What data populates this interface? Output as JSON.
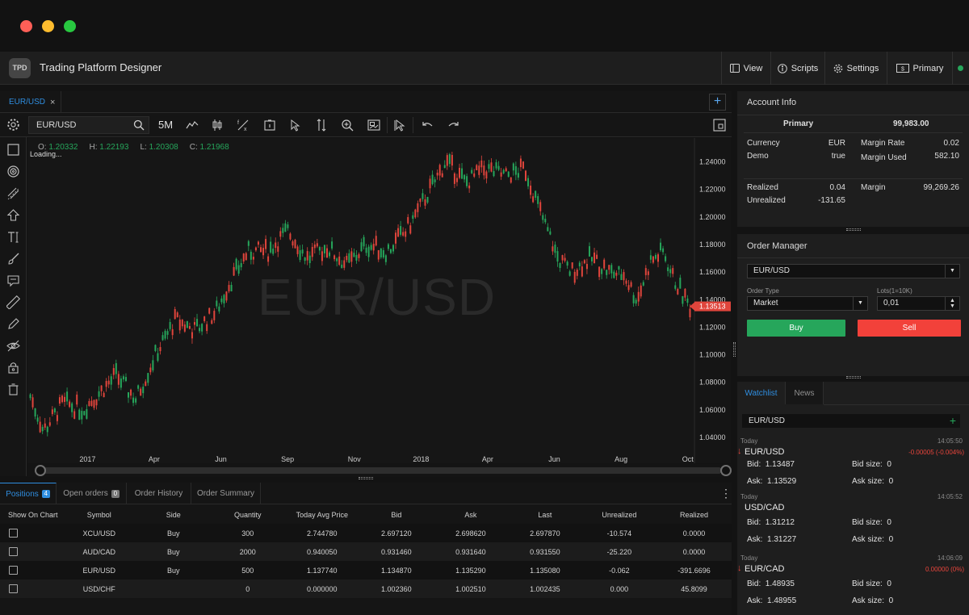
{
  "window": {
    "traffic_colors": {
      "close": "#fe5f57",
      "minimize": "#febc2e",
      "zoom": "#28c840"
    }
  },
  "app": {
    "logo_text": "TPD",
    "title": "Trading Platform Designer",
    "nav": [
      {
        "label": "View",
        "icon": "window-icon"
      },
      {
        "label": "Scripts",
        "icon": "info-icon"
      },
      {
        "label": "Settings",
        "icon": "gear-icon"
      },
      {
        "label": "Primary",
        "icon": "dollar-bill-icon"
      }
    ],
    "status_color": "#26a65b"
  },
  "chart_tab": {
    "label": "EUR/USD",
    "close": "×",
    "add": "+"
  },
  "toolbar": {
    "symbol": "EUR/USD",
    "timeframe": "5M"
  },
  "chart": {
    "ohlc": {
      "o_label": "O:",
      "o": "1.20332",
      "h_label": "H:",
      "h": "1.22193",
      "l_label": "L:",
      "l": "1.20308",
      "c_label": "C:",
      "c": "1.21968"
    },
    "loading": "Loading...",
    "watermark": "EUR/USD",
    "current_price": "1.13513"
  },
  "chart_data": {
    "type": "candlestick",
    "title": "EUR/USD",
    "x_ticks": [
      "2017",
      "Apr",
      "Jun",
      "Sep",
      "Nov",
      "2018",
      "Apr",
      "Jun",
      "Aug",
      "Oct"
    ],
    "y_ticks": [
      "1.24000",
      "1.22000",
      "1.20000",
      "1.18000",
      "1.16000",
      "1.14000",
      "1.12000",
      "1.10000",
      "1.08000",
      "1.06000",
      "1.04000"
    ],
    "ylim": [
      1.03,
      1.255
    ],
    "trend": [
      [
        0,
        1.07
      ],
      [
        0.02,
        1.045
      ],
      [
        0.05,
        1.065
      ],
      [
        0.08,
        1.06
      ],
      [
        0.1,
        1.07
      ],
      [
        0.13,
        1.085
      ],
      [
        0.16,
        1.068
      ],
      [
        0.19,
        1.1
      ],
      [
        0.22,
        1.125
      ],
      [
        0.25,
        1.118
      ],
      [
        0.28,
        1.13
      ],
      [
        0.3,
        1.15
      ],
      [
        0.33,
        1.175
      ],
      [
        0.36,
        1.175
      ],
      [
        0.39,
        1.19
      ],
      [
        0.42,
        1.17
      ],
      [
        0.45,
        1.178
      ],
      [
        0.48,
        1.165
      ],
      [
        0.51,
        1.18
      ],
      [
        0.54,
        1.175
      ],
      [
        0.57,
        1.19
      ],
      [
        0.6,
        1.215
      ],
      [
        0.63,
        1.24
      ],
      [
        0.66,
        1.225
      ],
      [
        0.69,
        1.235
      ],
      [
        0.72,
        1.23
      ],
      [
        0.75,
        1.235
      ],
      [
        0.78,
        1.195
      ],
      [
        0.8,
        1.17
      ],
      [
        0.82,
        1.16
      ],
      [
        0.85,
        1.17
      ],
      [
        0.88,
        1.16
      ],
      [
        0.9,
        1.158
      ],
      [
        0.92,
        1.14
      ],
      [
        0.94,
        1.168
      ],
      [
        0.96,
        1.175
      ],
      [
        0.975,
        1.155
      ],
      [
        1.0,
        1.135
      ]
    ],
    "current": 1.13513,
    "up_color": "#26a65b",
    "down_color": "#e0453c"
  },
  "positions_panel": {
    "tabs": [
      {
        "label": "Positions",
        "count": "4"
      },
      {
        "label": "Open orders",
        "count": "0"
      },
      {
        "label": "Order History"
      },
      {
        "label": "Order Summary"
      }
    ],
    "columns": [
      "Show On Chart",
      "Symbol",
      "Side",
      "Quantity",
      "Today Avg Price",
      "Bid",
      "Ask",
      "Last",
      "Unrealized",
      "Realized"
    ],
    "rows": [
      [
        "XCU/USD",
        "Buy",
        "300",
        "2.744780",
        "2.697120",
        "2.698620",
        "2.697870",
        "-10.574",
        "0.0000"
      ],
      [
        "AUD/CAD",
        "Buy",
        "2000",
        "0.940050",
        "0.931460",
        "0.931640",
        "0.931550",
        "-25.220",
        "0.0000"
      ],
      [
        "EUR/USD",
        "Buy",
        "500",
        "1.137740",
        "1.134870",
        "1.135290",
        "1.135080",
        "-0.062",
        "-391.6696"
      ],
      [
        "USD/CHF",
        "",
        "0",
        "0.000000",
        "1.002360",
        "1.002510",
        "1.002435",
        "0.000",
        "45.8099"
      ]
    ]
  },
  "account": {
    "title": "Account Info",
    "name": "Primary",
    "balance": "99,983.00",
    "left": [
      [
        "Currency",
        "EUR"
      ],
      [
        "Demo",
        "true"
      ]
    ],
    "right": [
      [
        "Margin Rate",
        "0.02"
      ],
      [
        "Margin Used",
        "582.10"
      ]
    ],
    "left2": [
      [
        "Realized",
        "0.04"
      ],
      [
        "Unrealized",
        "-131.65"
      ]
    ],
    "right2": [
      [
        "Margin",
        "99,269.26"
      ]
    ]
  },
  "order_manager": {
    "title": "Order Manager",
    "symbol": "EUR/USD",
    "order_type_label": "Order Type",
    "order_type": "Market",
    "lots_label": "Lots(1=10K)",
    "lots": "0,01",
    "buy": "Buy",
    "sell": "Sell",
    "buy_color": "#26a65b",
    "sell_color": "#f2413a"
  },
  "watchlist": {
    "tabs": [
      "Watchlist",
      "News"
    ],
    "search": "EUR/USD",
    "items": [
      {
        "day": "Today",
        "time": "14:05:50",
        "symbol": "EUR/USD",
        "change": "-0.00005 (-0.004%)",
        "bid_label": "Bid:",
        "bid": "1.13487",
        "ask_label": "Ask:",
        "ask": "1.13529",
        "bid_size_label": "Bid size:",
        "bid_size": "0",
        "ask_size_label": "Ask size:",
        "ask_size": "0",
        "down": true
      },
      {
        "day": "Today",
        "time": "14:05:52",
        "symbol": "USD/CAD",
        "change": "",
        "bid_label": "Bid:",
        "bid": "1.31212",
        "ask_label": "Ask:",
        "ask": "1.31227",
        "bid_size_label": "Bid size:",
        "bid_size": "0",
        "ask_size_label": "Ask size:",
        "ask_size": "0",
        "down": false
      },
      {
        "day": "Today",
        "time": "14:06:09",
        "symbol": "EUR/CAD",
        "change": "0.00000 (0%)",
        "bid_label": "Bid:",
        "bid": "1.48935",
        "ask_label": "Ask:",
        "ask": "1.48955",
        "bid_size_label": "Bid size:",
        "bid_size": "0",
        "ask_size_label": "Ask size:",
        "ask_size": "0",
        "down": true
      }
    ]
  }
}
